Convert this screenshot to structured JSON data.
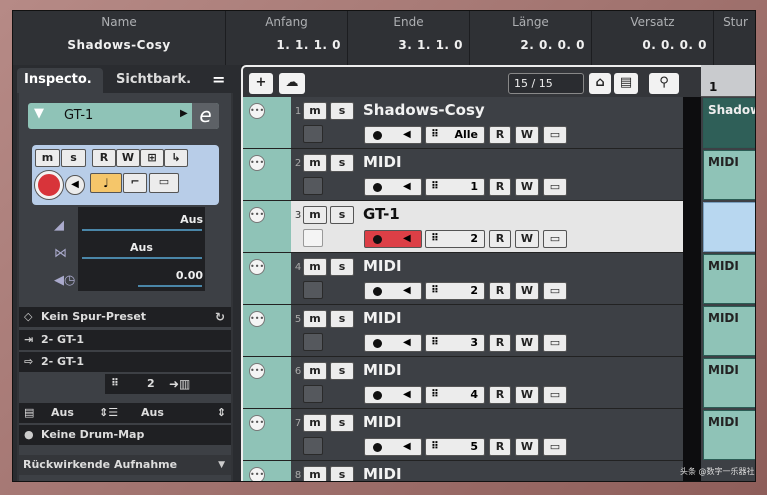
{
  "infoline": {
    "columns": [
      {
        "label": "Name",
        "value": "Shadows-Cosy"
      },
      {
        "label": "Anfang",
        "value": "1. 1. 1.   0"
      },
      {
        "label": "Ende",
        "value": "3. 1. 1.   0"
      },
      {
        "label": "Länge",
        "value": "2. 0. 0.   0"
      },
      {
        "label": "Versatz",
        "value": "0. 0. 0.   0"
      },
      {
        "label": "Stur",
        "value": ""
      }
    ]
  },
  "inspector": {
    "tabs": [
      "Inspecto.",
      "Sichtbark.",
      "="
    ],
    "track_name": "GT-1",
    "buttons": {
      "m": "m",
      "s": "s",
      "r": "R",
      "w": "W"
    },
    "volume": "Aus",
    "pan": "Aus",
    "delay": "0.00",
    "preset": "Kein Spur-Preset",
    "input": "2- GT-1",
    "output": "2- GT-1",
    "channel": "2",
    "bank": "Aus",
    "program": "Aus",
    "drum_map": "Keine Drum-Map",
    "retro_record": "Rückwirkende Aufnahme"
  },
  "toolbar": {
    "add": "+",
    "counter": "15 / 15"
  },
  "tracks": [
    {
      "number": "1",
      "name": "Shadows-Cosy",
      "channel": "Alle"
    },
    {
      "number": "2",
      "name": "MIDI",
      "channel": "1"
    },
    {
      "number": "3",
      "name": "GT-1",
      "channel": "2"
    },
    {
      "number": "4",
      "name": "MIDI",
      "channel": "2"
    },
    {
      "number": "5",
      "name": "MIDI",
      "channel": "3"
    },
    {
      "number": "6",
      "name": "MIDI",
      "channel": "4"
    },
    {
      "number": "7",
      "name": "MIDI",
      "channel": "5"
    },
    {
      "number": "8",
      "name": "MIDI",
      "channel": ""
    }
  ],
  "project": {
    "ruler": "1",
    "parts": [
      "Shadow",
      "MIDI",
      "",
      "MIDI",
      "MIDI",
      "MIDI",
      "MIDI"
    ]
  },
  "watermark": "头条 @数字一乐器社"
}
